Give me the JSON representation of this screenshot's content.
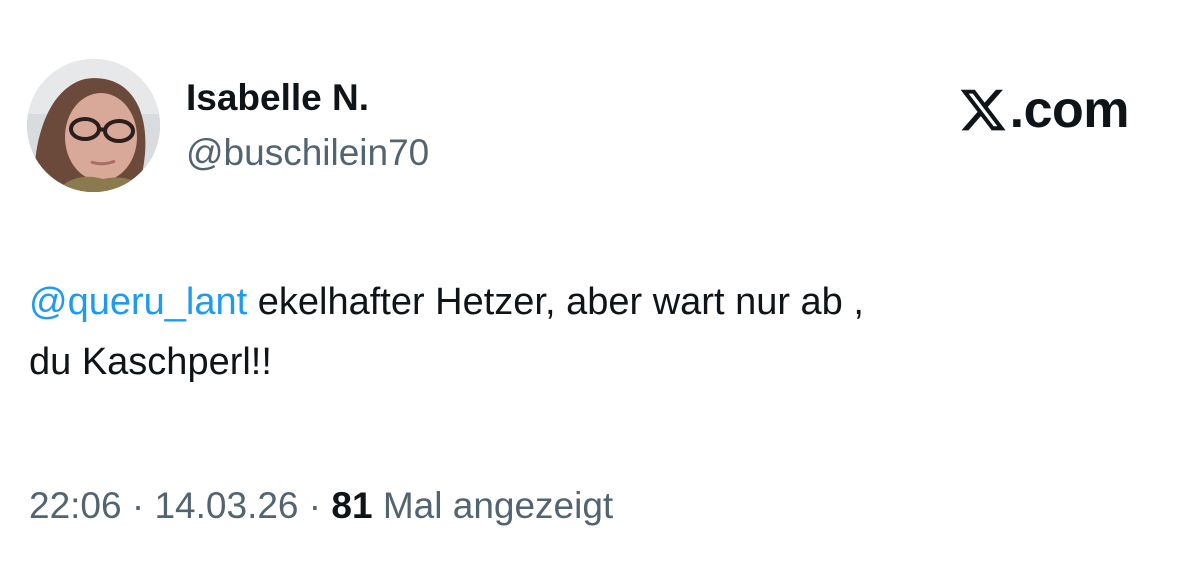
{
  "author": {
    "display_name": "Isabelle N.",
    "handle": "@buschilein70",
    "avatar_icon": "profile-photo"
  },
  "brand": {
    "logo_icon": "x-logo-icon",
    "label": ".com"
  },
  "tweet": {
    "mention": "@queru_lant",
    "text_line1": " ekelhafter Hetzer, aber wart nur ab ,",
    "text_line2": "du Kaschperl!!"
  },
  "meta": {
    "time": "22:06",
    "separator1": " · ",
    "date": "14.03.26",
    "separator2": " · ",
    "views_count": "81",
    "views_label": " Mal angezeigt"
  },
  "colors": {
    "mention": "#1d9bf0",
    "secondary_text": "#536471",
    "primary_text": "#0f1419",
    "background": "#ffffff"
  }
}
